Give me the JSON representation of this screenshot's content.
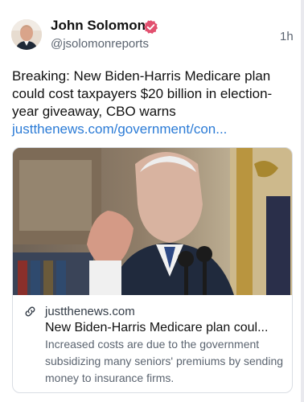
{
  "post": {
    "author_name": "John Solomon",
    "handle": "@jsolomonreports",
    "time": "1h",
    "text": "Breaking: New Biden-Harris Medicare plan could cost taxpayers $20 billion in election-year giveaway, CBO warns",
    "link": "justthenews.com/government/con..."
  },
  "link_card": {
    "domain": "justthenews.com",
    "title": "New Biden-Harris Medicare plan coul...",
    "description": "Increased costs are due to the government subsidizing many seniors' premiums by sending money to insurance firms."
  },
  "icons": {
    "verified": "verified-badge-icon",
    "link": "link-icon"
  },
  "colors": {
    "link": "#2b7bd6",
    "verified": "#e2506f",
    "muted": "#5b6470"
  }
}
